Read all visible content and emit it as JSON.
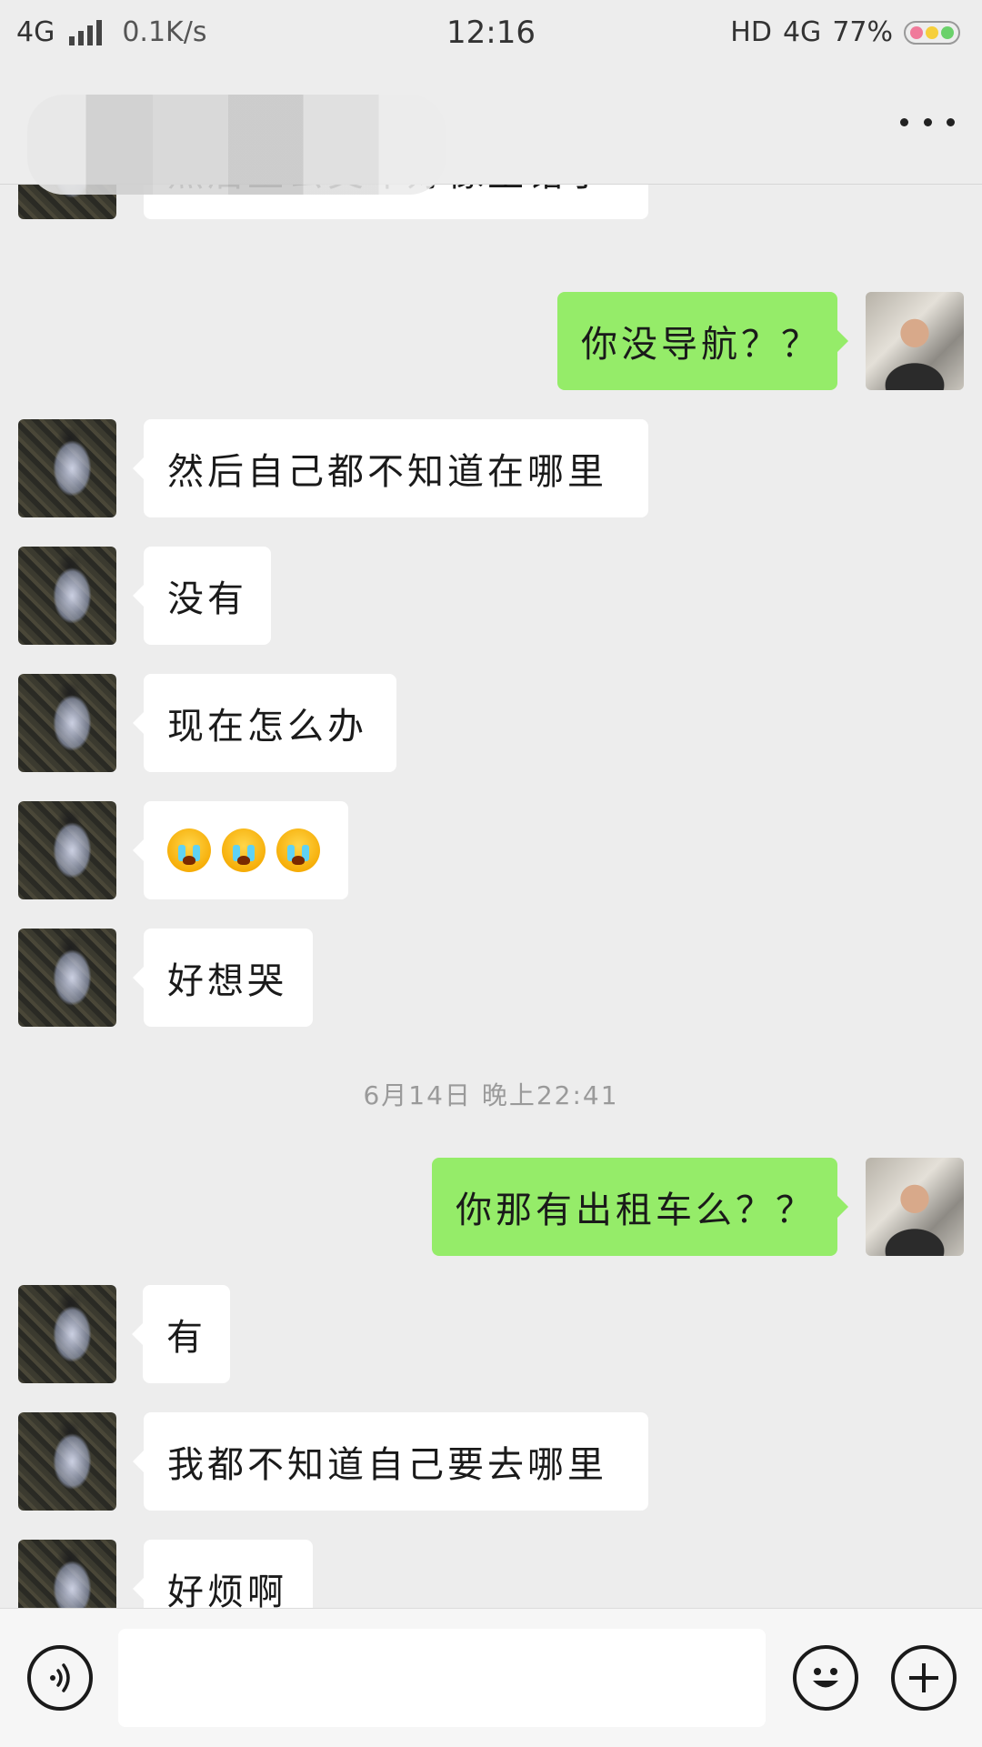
{
  "status_bar": {
    "network": "4G",
    "speed": "0.1K/s",
    "time": "12:16",
    "hd": "HD",
    "network_right": "4G",
    "battery": "77%"
  },
  "header": {
    "title": "",
    "more_icon": "more-dots-icon"
  },
  "messages": [
    {
      "side": "left",
      "text": "然后坐公交车好像坐错了"
    },
    {
      "side": "right",
      "text": "你没导航？？"
    },
    {
      "side": "left",
      "text": "然后自己都不知道在哪里"
    },
    {
      "side": "left",
      "text": "没有"
    },
    {
      "side": "left",
      "text": "现在怎么办"
    },
    {
      "side": "left",
      "text": "",
      "emoji": [
        "crying-face-icon",
        "crying-face-icon",
        "crying-face-icon"
      ]
    },
    {
      "side": "left",
      "text": "好想哭"
    },
    {
      "side": "right",
      "text": "你那有出租车么？？"
    },
    {
      "side": "left",
      "text": "有"
    },
    {
      "side": "left",
      "text": "我都不知道自己要去哪里"
    },
    {
      "side": "left",
      "text": "好烦啊"
    }
  ],
  "timestamp": "6月14日 晚上22:41",
  "input_bar": {
    "voice_icon": "voice-icon",
    "text_value": "",
    "emoji_icon": "smiley-icon",
    "plus_icon": "plus-icon"
  },
  "colors": {
    "background": "#ededed",
    "bubble_self": "#95ec69",
    "bubble_other": "#ffffff"
  }
}
